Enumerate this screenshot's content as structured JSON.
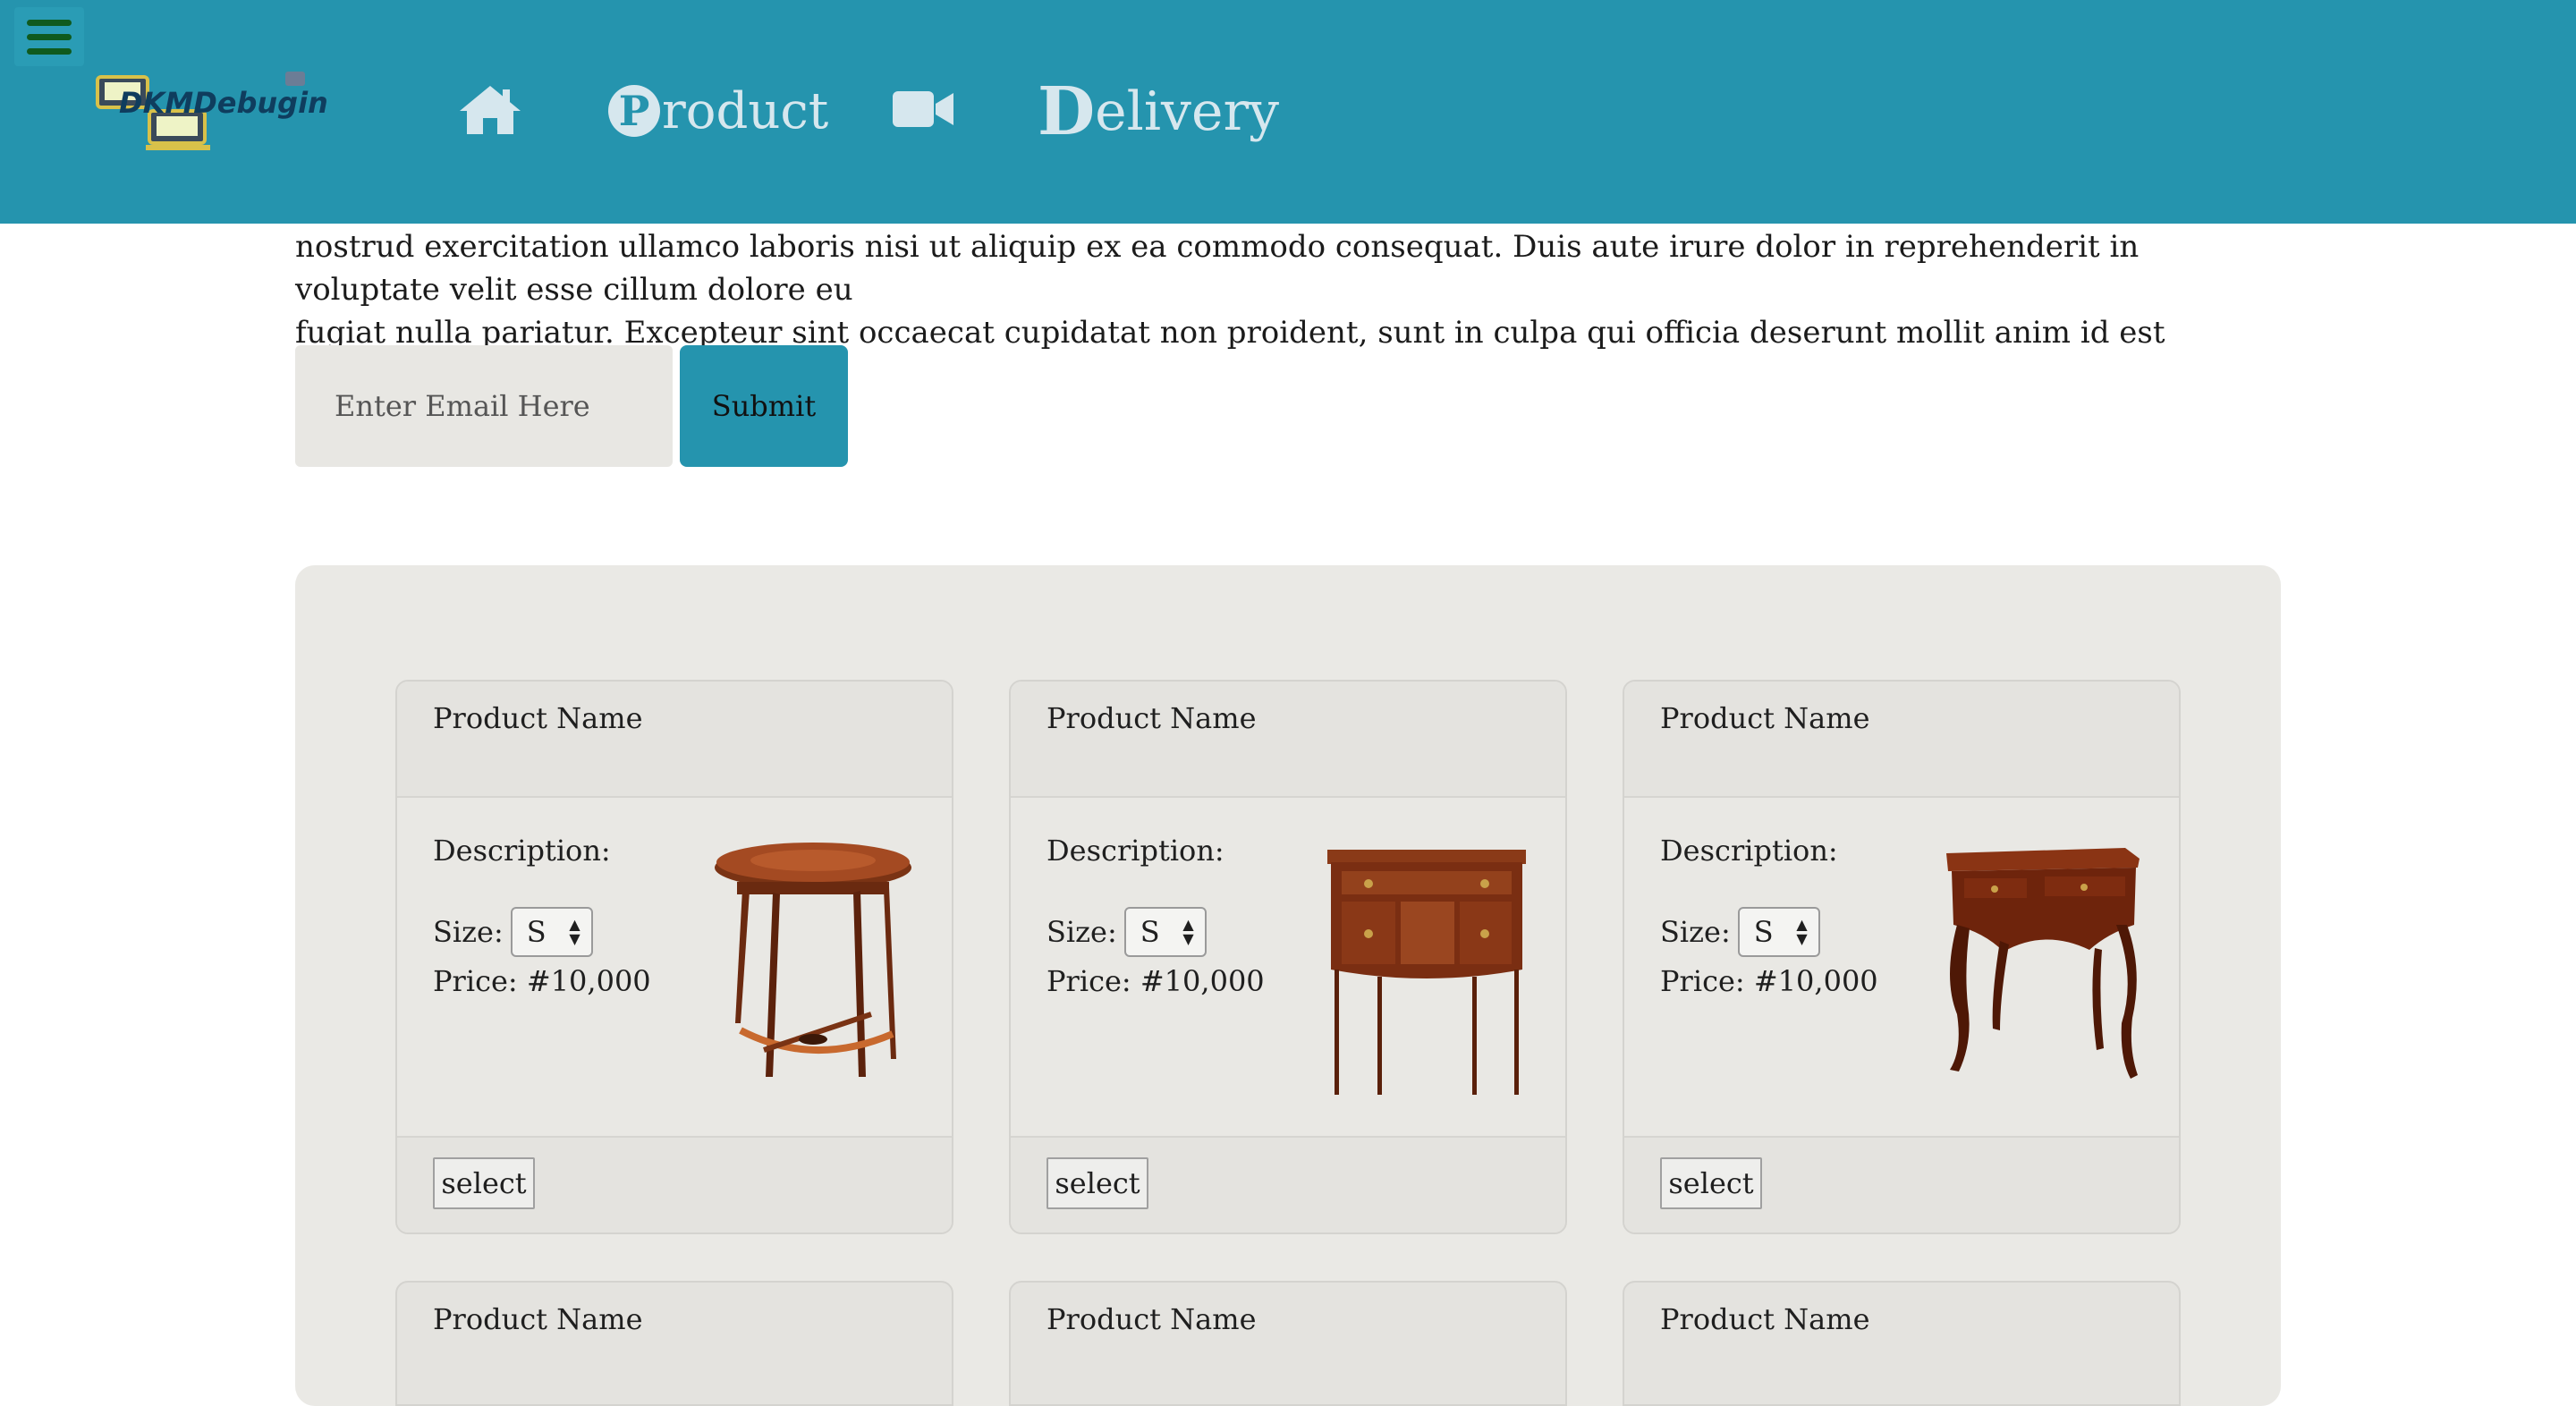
{
  "header": {
    "logo_text": "DKMDebugin",
    "nav": {
      "home_icon": "home-icon",
      "product_initial": "P",
      "product_rest": "roduct",
      "video_icon": "video-icon",
      "delivery_initial": "D",
      "delivery_rest": "elivery"
    },
    "menu_icon": "hamburger-icon"
  },
  "intro": {
    "line_cut": "Ut enim ad minim veniam, quis nostrud exercitation ullamco laboris nisi ut aliquip ex ea commodo consequat. Duis aute irure dolor in reprehenderit in voluptate velit esse cillum dolore eu",
    "line1": "nostrud exercitation ullamco laboris nisi ut aliquip ex ea commodo consequat. Duis aute irure dolor in reprehenderit in voluptate velit esse cillum dolore eu",
    "line2": "fugiat nulla pariatur. Excepteur sint occaecat cupidatat non proident, sunt in culpa qui officia deserunt mollit anim id est laborum."
  },
  "newsletter": {
    "email_placeholder": "Enter Email Here",
    "submit_label": "Submit"
  },
  "products": [
    {
      "name": "Product Name",
      "description_label": "Description:",
      "size_label": "Size:",
      "size_value": "S",
      "price_label": "Price: #10,000",
      "select_label": "select",
      "image": "round-side-table"
    },
    {
      "name": "Product Name",
      "description_label": "Description:",
      "size_label": "Size:",
      "size_value": "S",
      "price_label": "Price: #10,000",
      "select_label": "select",
      "image": "sideboard-cabinet"
    },
    {
      "name": "Product Name",
      "description_label": "Description:",
      "size_label": "Size:",
      "size_value": "S",
      "price_label": "Price: #10,000",
      "select_label": "select",
      "image": "lowboy-table"
    }
  ],
  "products_row2": [
    {
      "name": "Product Name"
    },
    {
      "name": "Product Name"
    },
    {
      "name": "Product Name"
    }
  ],
  "colors": {
    "header": "#2594ae",
    "panel": "#eae9e5",
    "accent": "#2594ae"
  }
}
